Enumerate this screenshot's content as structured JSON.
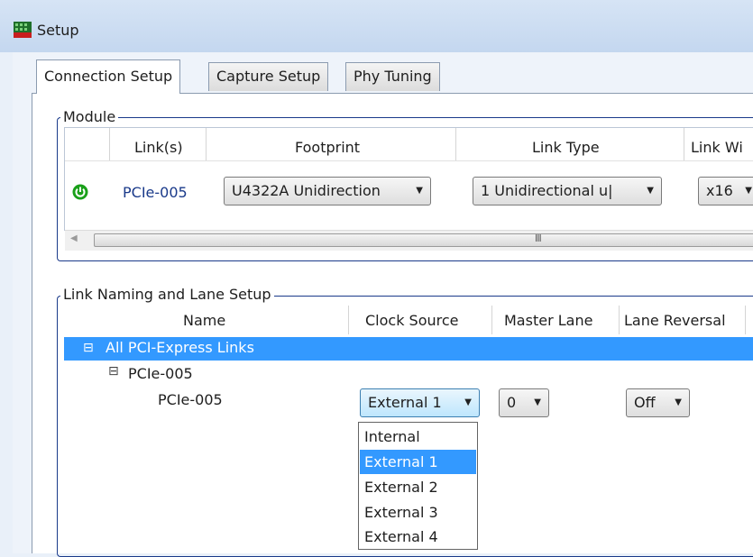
{
  "window": {
    "title": "Setup"
  },
  "tabs": [
    {
      "label": "Connection Setup",
      "active": true
    },
    {
      "label": "Capture Setup",
      "active": false
    },
    {
      "label": "Phy Tuning",
      "active": false
    }
  ],
  "module": {
    "legend": "Module",
    "columns": [
      "Link(s)",
      "Footprint",
      "Link Type",
      "Link Wi"
    ],
    "row": {
      "status_icon": "power-on-icon",
      "link": "PCIe-005",
      "footprint": "U4322A Unidirection",
      "link_type": "1 Unidirectional u|",
      "link_width": "x16"
    },
    "scrollbar": {
      "grip": "III"
    }
  },
  "lane_setup": {
    "legend": "Link Naming and Lane Setup",
    "columns": [
      "Name",
      "Clock Source",
      "Master Lane",
      "Lane Reversal"
    ],
    "root": {
      "expander": "⊟",
      "label": "All PCI-Express Links"
    },
    "group": {
      "expander": "⊟",
      "label": "PCIe-005"
    },
    "item": {
      "name": "PCIe-005",
      "clock_source": "External 1",
      "master_lane": "0",
      "lane_reversal": "Off"
    },
    "clock_options": [
      "Internal",
      "External 1",
      "External 2",
      "External 3",
      "External 4"
    ],
    "selected_clock_index": 1
  },
  "colors": {
    "accent": "#3399ff",
    "group_border": "#1a3a8a",
    "link_text": "#1a3a8a",
    "power_icon": "#1aa01a"
  }
}
